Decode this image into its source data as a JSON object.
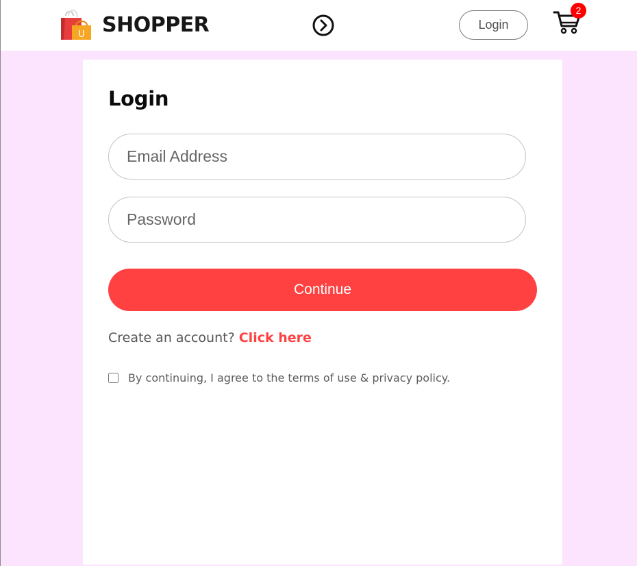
{
  "navbar": {
    "brand_name": "SHOPPER",
    "logo_letter": "U",
    "toggle_icon": "chevron-right-circle-icon",
    "login_label": "Login",
    "cart_icon": "cart-icon",
    "cart_count": "2"
  },
  "login_form": {
    "title": "Login",
    "email_placeholder": "Email Address",
    "email_value": "",
    "password_placeholder": "Password",
    "password_value": "",
    "continue_label": "Continue",
    "signup_prompt": "Create an account?",
    "signup_link": "Click here",
    "agree_text": "By continuing, I agree to the terms of use & privacy policy.",
    "agree_checked": false
  },
  "colors": {
    "accent": "#ff4141",
    "page_background": "#fce3fe",
    "badge": "#ff0000"
  }
}
